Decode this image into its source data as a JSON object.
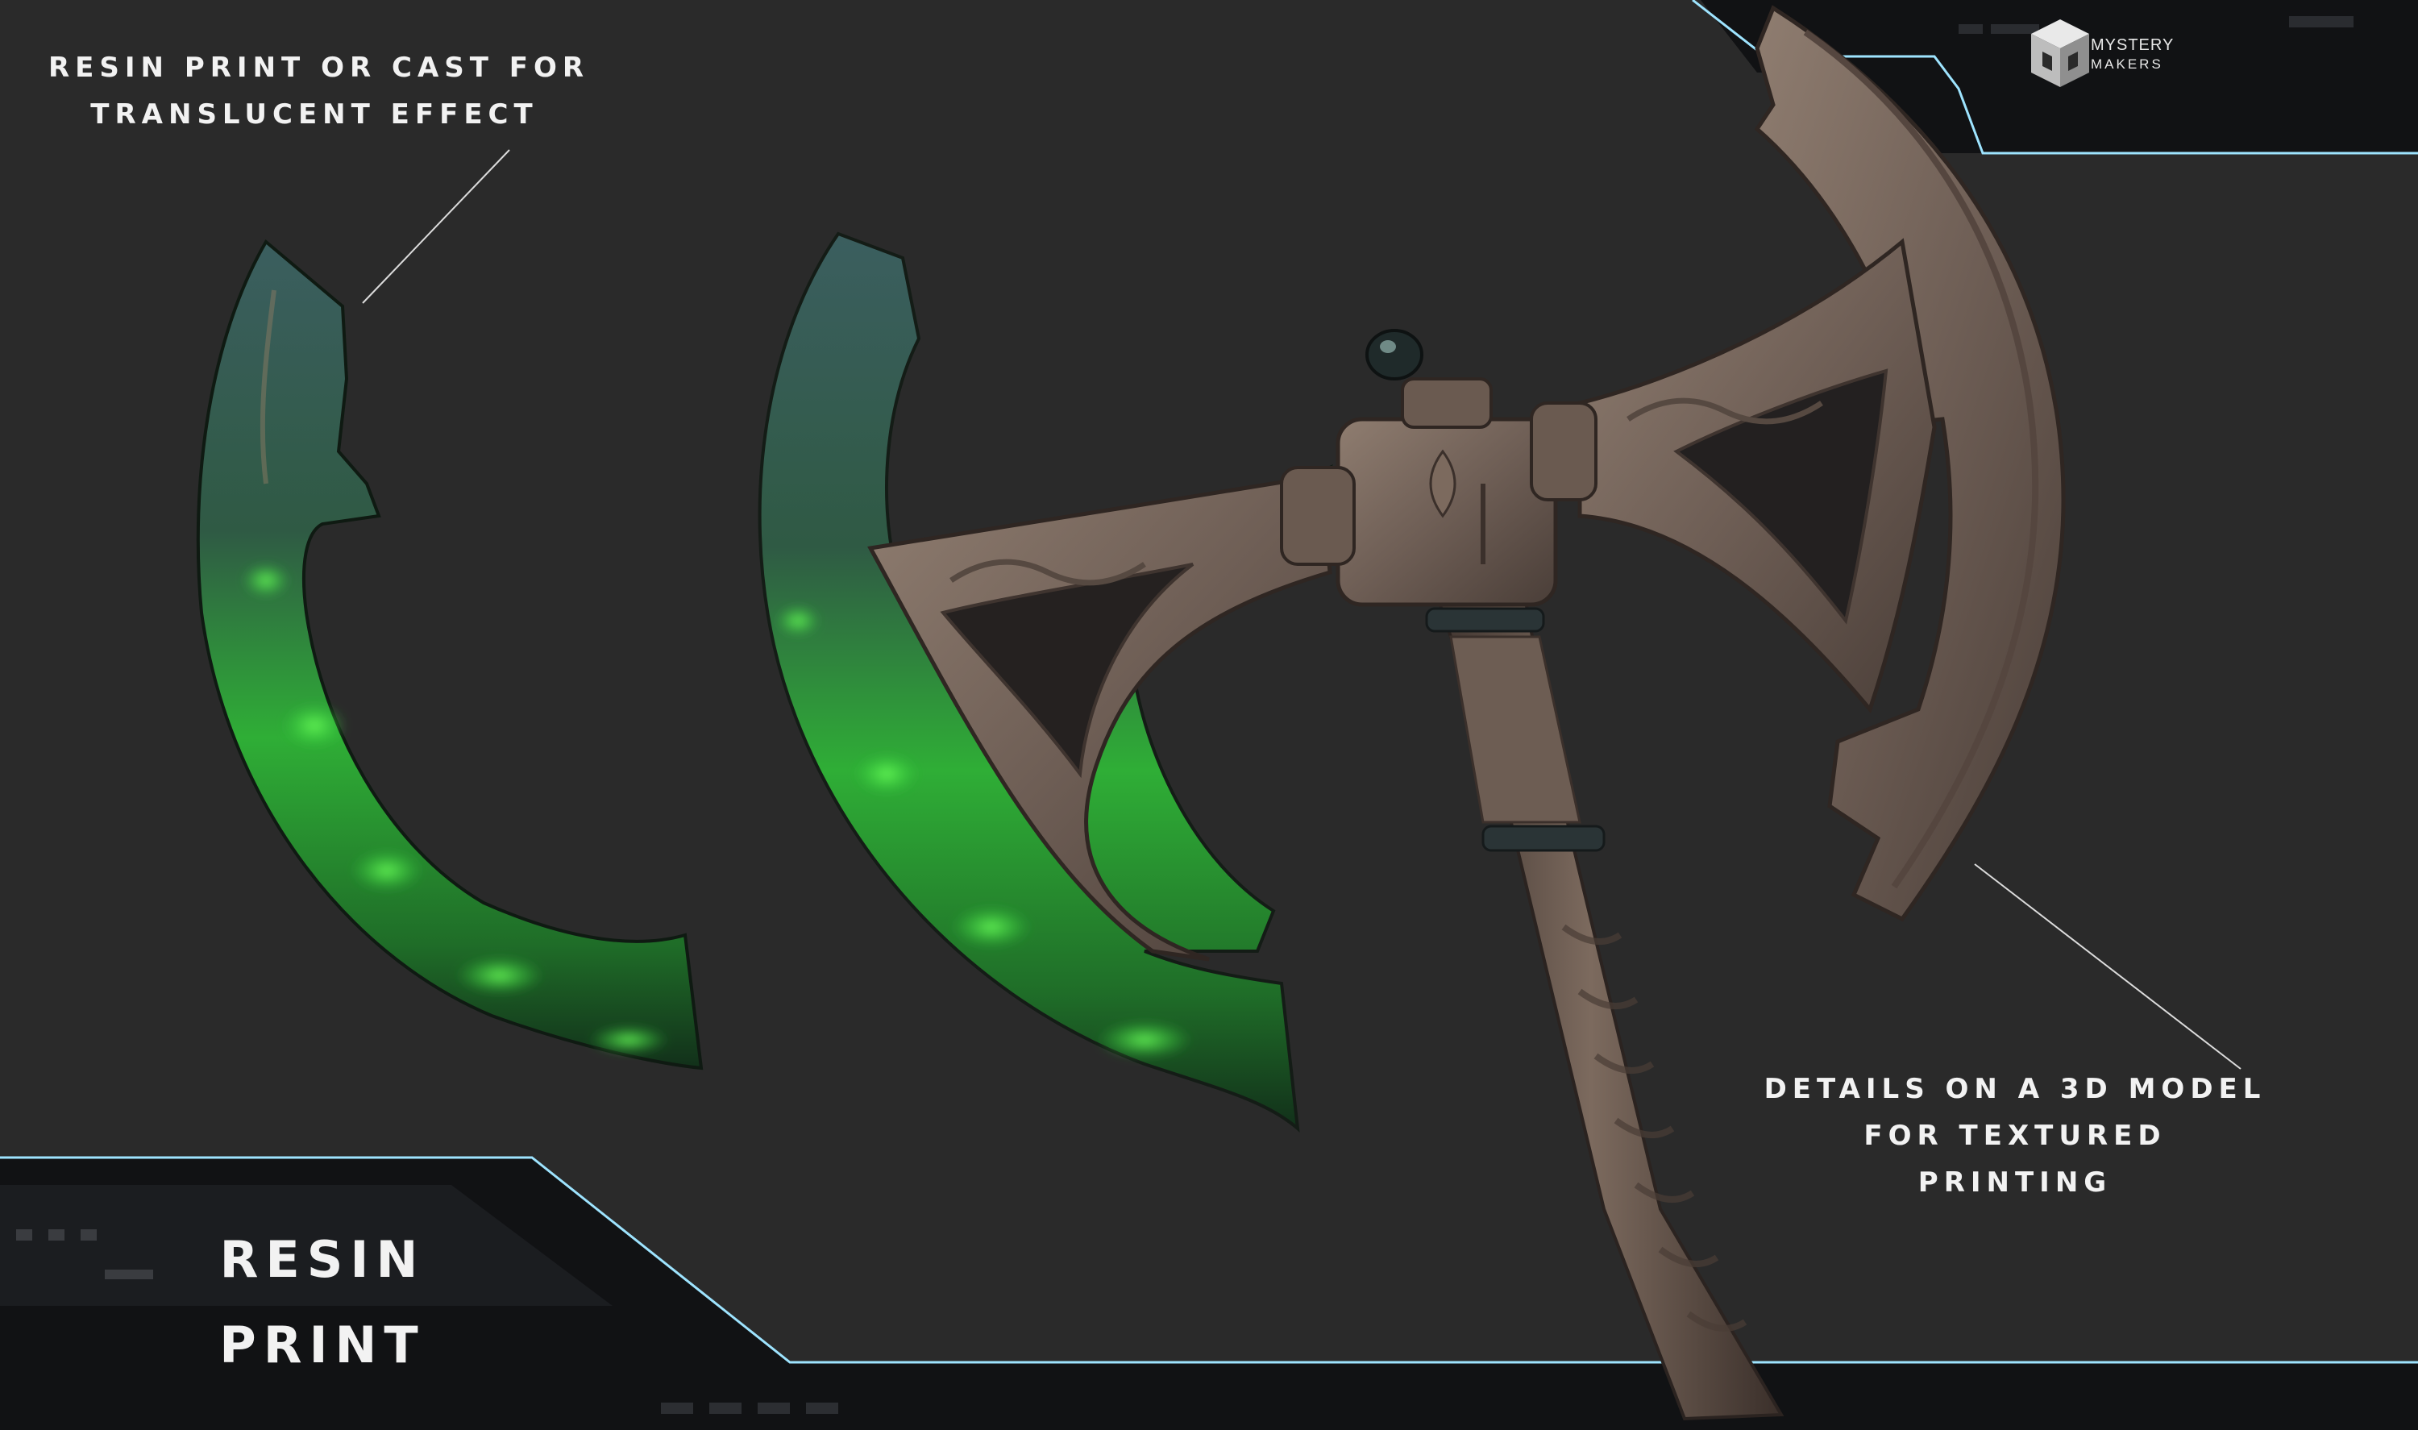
{
  "captions": {
    "resin_cast": [
      "RESIN PRINT OR CAST FOR",
      "TRANSLUCENT EFFECT"
    ],
    "details": [
      "DETAILS ON A 3D MODEL",
      "FOR TEXTURED",
      "PRINTING"
    ],
    "resin_print": [
      "RESIN",
      "PRINT"
    ]
  },
  "brand": {
    "line1": "MYSTERY",
    "line2": "MAKERS"
  },
  "colors": {
    "background": "#2a2a2a",
    "frame_dark": "#111214",
    "frame_glow": "#9ee4ff",
    "bronze": "#6e5e55",
    "bronze_light": "#8a786c",
    "resin_green": "#2fd33a",
    "resin_dark": "#1e3a28"
  },
  "icons": [
    "mystery-makers-cube-logo"
  ]
}
